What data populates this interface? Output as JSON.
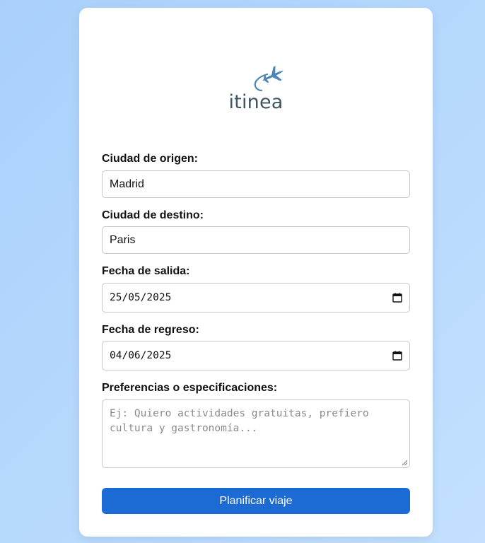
{
  "brand": {
    "name": "itinea",
    "icon": "airplane-icon"
  },
  "form": {
    "origin": {
      "label": "Ciudad de origen:",
      "value": "Madrid"
    },
    "destination": {
      "label": "Ciudad de destino:",
      "value": "Paris"
    },
    "departure": {
      "label": "Fecha de salida:",
      "value": "25/05/2025",
      "icon": "calendar-icon"
    },
    "return": {
      "label": "Fecha de regreso:",
      "value": "04/06/2025",
      "icon": "calendar-icon"
    },
    "preferences": {
      "label": "Preferencias o especificaciones:",
      "placeholder": "Ej: Quiero actividades gratuitas, prefiero cultura y gastronomía..."
    },
    "submit_label": "Planificar viaje"
  },
  "colors": {
    "background": "#b6d8fd",
    "accent": "#1c6bd4",
    "logo": "#3e5560",
    "plane": "#4f86b5"
  }
}
